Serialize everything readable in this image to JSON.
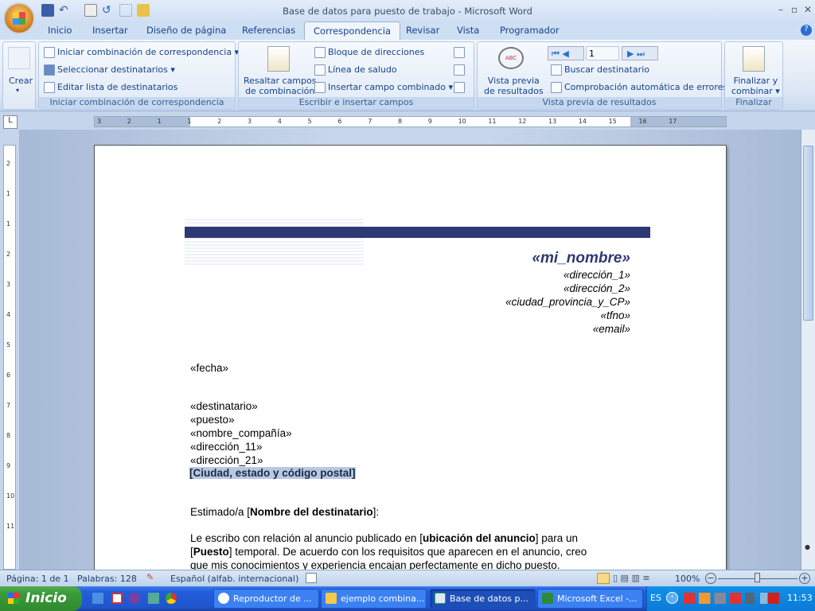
{
  "window": {
    "title": "Base de datos para puesto de trabajo - Microsoft Word"
  },
  "tabs": [
    "Inicio",
    "Insertar",
    "Diseño de página",
    "Referencias",
    "Correspondencia",
    "Revisar",
    "Vista",
    "Programador"
  ],
  "ribbon": {
    "crear": {
      "label": "Crear",
      "group": ""
    },
    "iniciar": {
      "items": [
        "Iniciar combinación de correspondencia",
        "Seleccionar destinatarios",
        "Editar lista de destinatarios"
      ],
      "group": "Iniciar combinación de correspondencia"
    },
    "escribir": {
      "resaltar": [
        "Resaltar campos",
        "de combinación"
      ],
      "items": [
        "Bloque de direcciones",
        "Línea de saludo",
        "Insertar campo combinado"
      ],
      "group": "Escribir e insertar campos"
    },
    "vista": {
      "preview": [
        "Vista previa",
        "de resultados"
      ],
      "record": "1",
      "buscar": "Buscar destinatario",
      "comprobacion": "Comprobación automática de errores",
      "group": "Vista previa de resultados"
    },
    "finalizar": {
      "label": [
        "Finalizar y",
        "combinar"
      ],
      "group": "Finalizar"
    }
  },
  "ruler": {
    "ticks": [
      "3",
      "2",
      "1",
      "1",
      "2",
      "3",
      "4",
      "5",
      "6",
      "7",
      "8",
      "9",
      "10",
      "11",
      "12",
      "13",
      "14",
      "15",
      "16",
      "17"
    ]
  },
  "vruler": {
    "ticks": [
      "2",
      "1",
      "1",
      "2",
      "3",
      "4",
      "5",
      "6",
      "7",
      "8",
      "9",
      "10",
      "11"
    ]
  },
  "document": {
    "name": "«mi_nombre»",
    "sender": [
      "«dirección_1»",
      "«dirección_2»",
      "«ciudad_provincia_y_CP»",
      "«tfno»",
      "«email»"
    ],
    "fecha": "«fecha»",
    "recipient": [
      "«destinatario»",
      "«puesto»",
      "«nombre_compañía»",
      "«dirección_11»",
      "«dirección_21»"
    ],
    "city_placeholder": "[Ciudad, estado y código postal]",
    "greeting": {
      "pre": "Estimado/a [",
      "bold": "Nombre del destinatario",
      "post": "]:"
    },
    "body": {
      "p1": "Le escribo con relación al anuncio publicado en [",
      "b1": "ubicación del anuncio",
      "p2": "] para un",
      "p3": "[",
      "b2": "Puesto",
      "p4": "] temporal. De acuerdo con los requisitos  que aparecen en el anuncio, creo",
      "p5": "que mis conocimientos y experiencia encajan perfectamente en dicho puesto."
    }
  },
  "status": {
    "page": "Página: 1 de 1",
    "words": "Palabras: 128",
    "language": "Español (alfab. internacional)",
    "zoom": "100%"
  },
  "taskbar": {
    "start": "Inicio",
    "tasks": [
      "Reproductor de ...",
      "ejemplo combina...",
      "Base de datos p...",
      "Microsoft Excel -..."
    ],
    "lang": "ES",
    "clock": "11:53"
  },
  "colors": {
    "accent": "#2e3874",
    "tab_text": "#15428b",
    "taskbar": "#245edb"
  }
}
